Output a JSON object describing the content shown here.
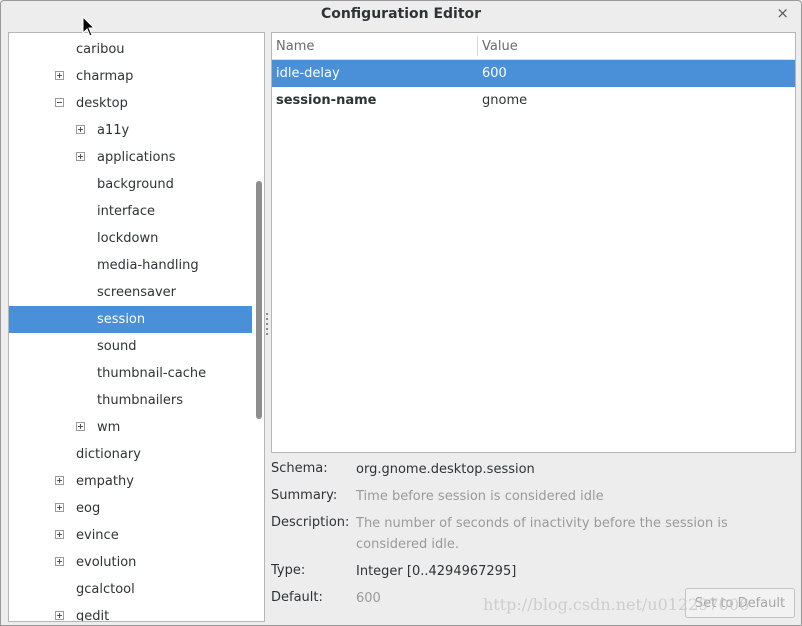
{
  "window": {
    "title": "Configuration Editor",
    "close_glyph": "×"
  },
  "tree": {
    "items": [
      {
        "label": "caribou",
        "level": 0,
        "expander": "none",
        "selected": false
      },
      {
        "label": "charmap",
        "level": 0,
        "expander": "collapsed",
        "selected": false
      },
      {
        "label": "desktop",
        "level": 0,
        "expander": "expanded",
        "selected": false
      },
      {
        "label": "a11y",
        "level": 1,
        "expander": "collapsed",
        "selected": false
      },
      {
        "label": "applications",
        "level": 1,
        "expander": "collapsed",
        "selected": false
      },
      {
        "label": "background",
        "level": 1,
        "expander": "none",
        "selected": false
      },
      {
        "label": "interface",
        "level": 1,
        "expander": "none",
        "selected": false
      },
      {
        "label": "lockdown",
        "level": 1,
        "expander": "none",
        "selected": false
      },
      {
        "label": "media-handling",
        "level": 1,
        "expander": "none",
        "selected": false
      },
      {
        "label": "screensaver",
        "level": 1,
        "expander": "none",
        "selected": false
      },
      {
        "label": "session",
        "level": 1,
        "expander": "none",
        "selected": true
      },
      {
        "label": "sound",
        "level": 1,
        "expander": "none",
        "selected": false
      },
      {
        "label": "thumbnail-cache",
        "level": 1,
        "expander": "none",
        "selected": false
      },
      {
        "label": "thumbnailers",
        "level": 1,
        "expander": "none",
        "selected": false
      },
      {
        "label": "wm",
        "level": 1,
        "expander": "collapsed",
        "selected": false
      },
      {
        "label": "dictionary",
        "level": 0,
        "expander": "none",
        "selected": false
      },
      {
        "label": "empathy",
        "level": 0,
        "expander": "collapsed",
        "selected": false
      },
      {
        "label": "eog",
        "level": 0,
        "expander": "collapsed",
        "selected": false
      },
      {
        "label": "evince",
        "level": 0,
        "expander": "collapsed",
        "selected": false
      },
      {
        "label": "evolution",
        "level": 0,
        "expander": "collapsed",
        "selected": false
      },
      {
        "label": "gcalctool",
        "level": 0,
        "expander": "none",
        "selected": false
      },
      {
        "label": "gedit",
        "level": 0,
        "expander": "collapsed",
        "selected": false
      }
    ]
  },
  "keys": {
    "columns": {
      "name": "Name",
      "value": "Value"
    },
    "rows": [
      {
        "name": "idle-delay",
        "value": "600",
        "selected": true,
        "bold": false
      },
      {
        "name": "session-name",
        "value": "gnome",
        "selected": false,
        "bold": true
      }
    ]
  },
  "details": {
    "schema_label": "Schema:",
    "schema_value": "org.gnome.desktop.session",
    "summary_label": "Summary:",
    "summary_value": "Time before session is considered idle",
    "description_label": "Description:",
    "description_value": "The number of seconds of inactivity before the session is considered idle.",
    "type_label": "Type:",
    "type_value": "Integer [0..4294967295]",
    "default_label": "Default:",
    "default_value": "600",
    "set_default_button": "Set to Default"
  },
  "watermark": "http://blog.csdn.net/u012297006",
  "colors": {
    "selection": "#4a90d9",
    "window_bg": "#ededed",
    "muted_text": "#9a9a9a"
  }
}
